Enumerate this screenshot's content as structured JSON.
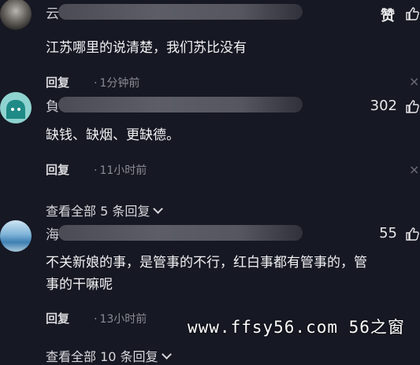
{
  "comments": [
    {
      "name_fragment": "云",
      "text": "江苏哪里的说清楚，我们苏比没有",
      "reply_label": "回复",
      "time": "1分钟前",
      "like_label": "赞"
    },
    {
      "name_fragment": "負",
      "text": "缺钱、缺烟、更缺德。",
      "reply_label": "回复",
      "time": "11小时前",
      "like_count": "302",
      "view_all": "查看全部 5 条回复"
    },
    {
      "name_fragment": "海",
      "text_line1": "不关新娘的事，是管事的不行，红白事都有管事的，管",
      "text_line2": "事的干嘛呢",
      "reply_label": "回复",
      "time": "13小时前",
      "like_count": "55",
      "view_all": "查看全部 10 条回复"
    }
  ],
  "close_symbol": "×",
  "time_dot": "·",
  "watermark": "www.ffsy56.com 56之窗"
}
